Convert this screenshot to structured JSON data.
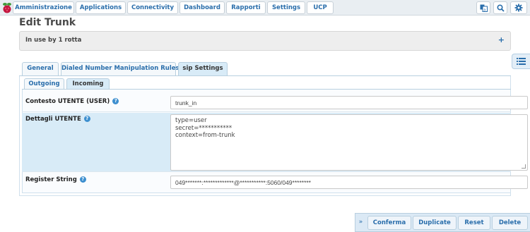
{
  "nav": {
    "items": [
      "Amministrazione",
      "Applications",
      "Connectivity",
      "Dashboard",
      "Rapporti",
      "Settings",
      "UCP"
    ],
    "icons": [
      "language-icon",
      "search-icon",
      "gear-icon"
    ]
  },
  "page": {
    "title": "Edit Trunk"
  },
  "inuse": {
    "label": "In use by 1 rotta",
    "expand": "+"
  },
  "tabs": [
    "General",
    "Dialed Number Manipulation Rules",
    "sip Settings"
  ],
  "subtabs": [
    "Outgoing",
    "Incoming"
  ],
  "form": {
    "context": {
      "label": "Contesto UTENTE (USER)",
      "value": "trunk_in"
    },
    "details": {
      "label": "Dettagli UTENTE",
      "lines": [
        "type=user",
        "secret=***********",
        "context=from-trunk"
      ]
    },
    "register": {
      "label": "Register String",
      "value": "049*******:*************@***********:5060/049********"
    },
    "help_glyph": "?"
  },
  "actions": {
    "arrow": "»",
    "buttons": [
      "Conferma",
      "Duplicate",
      "Reset",
      "Delete"
    ]
  },
  "colors": {
    "link": "#2a6eab",
    "active_tab": "#d8ebf7",
    "help": "#3d8fcf"
  }
}
